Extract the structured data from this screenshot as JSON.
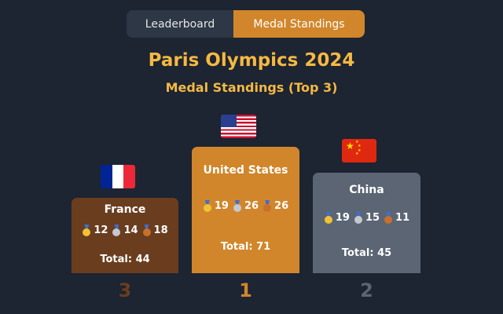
{
  "tabs": [
    {
      "label": "Leaderboard",
      "active": false
    },
    {
      "label": "Medal Standings",
      "active": true
    }
  ],
  "title": "Paris Olympics 2024",
  "subtitle": "Medal Standings (Top 3)",
  "colors": {
    "background": "#1d2432",
    "accent": "#d1862b",
    "title": "#f4b942",
    "first": "#d1862b",
    "second": "#5b6574",
    "third": "#6b3d1f"
  },
  "podium": [
    {
      "country": "France",
      "flag": "flag-france-icon",
      "gold": "12",
      "silver": "14",
      "bronze": "18",
      "total": "Total: 44",
      "rank": "3"
    },
    {
      "country": "United States",
      "flag": "flag-usa-icon",
      "gold": "19",
      "silver": "26",
      "bronze": "26",
      "total": "Total: 71",
      "rank": "1"
    },
    {
      "country": "China",
      "flag": "flag-china-icon",
      "gold": "19",
      "silver": "15",
      "bronze": "11",
      "total": "Total: 45",
      "rank": "2"
    }
  ]
}
